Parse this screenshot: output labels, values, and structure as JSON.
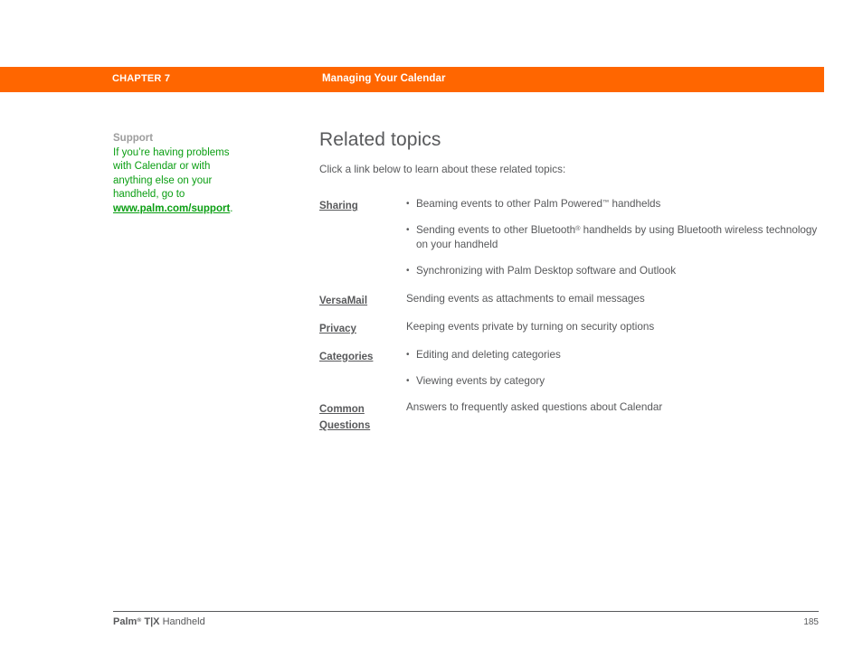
{
  "header": {
    "chapter": "CHAPTER 7",
    "title": "Managing Your Calendar",
    "background_color": "#FF6600",
    "text_color": "#FFFFFF"
  },
  "sidebar": {
    "heading": "Support",
    "body_line1": "If you’re having problems",
    "body_line2": "with Calendar or with",
    "body_line3": "anything else on your",
    "body_line4": "handheld, go to",
    "link_text": "www.palm.com/support",
    "link_trailing": ".",
    "text_color": "#0A9E12",
    "heading_color": "#9D9D9D"
  },
  "main": {
    "title": "Related topics",
    "intro": "Click a link below to learn about these related topics:",
    "topics": [
      {
        "link": "Sharing",
        "link_line2": "",
        "bulleted": true,
        "items": [
          {
            "prefix": "Beaming events to other Palm Powered",
            "sup": "™",
            "suffix": " handhelds"
          },
          {
            "prefix": "Sending events to other Bluetooth",
            "sup": "®",
            "suffix": " handhelds by using Bluetooth wireless technology on your handheld"
          },
          {
            "prefix": "Synchronizing with Palm Desktop software and Outlook",
            "sup": "",
            "suffix": ""
          }
        ]
      },
      {
        "link": "VersaMail",
        "link_line2": "",
        "bulleted": false,
        "items": [
          {
            "prefix": "Sending events as attachments to email messages",
            "sup": "",
            "suffix": ""
          }
        ]
      },
      {
        "link": "Privacy",
        "link_line2": "",
        "bulleted": false,
        "items": [
          {
            "prefix": "Keeping events private by turning on security options",
            "sup": "",
            "suffix": ""
          }
        ]
      },
      {
        "link": "Categories",
        "link_line2": "",
        "bulleted": true,
        "items": [
          {
            "prefix": "Editing and deleting categories",
            "sup": "",
            "suffix": ""
          },
          {
            "prefix": "Viewing events by category",
            "sup": "",
            "suffix": ""
          }
        ]
      },
      {
        "link": "Common ",
        "link_line2": "Questions",
        "bulleted": false,
        "items": [
          {
            "prefix": "Answers to frequently asked questions about Calendar",
            "sup": "",
            "suffix": ""
          }
        ]
      }
    ]
  },
  "footer": {
    "brand": "Palm",
    "brand_sup": "®",
    "model": " T|X",
    "product": " Handheld",
    "page_number": "185"
  }
}
